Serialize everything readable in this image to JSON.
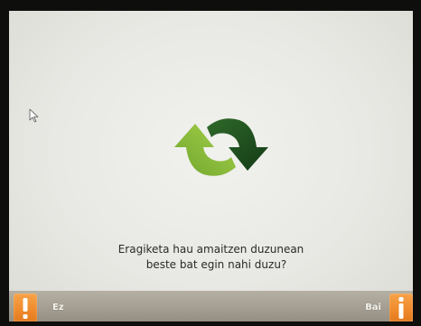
{
  "dialog": {
    "line1": "Eragiketa hau amaitzen duzunean",
    "line2": "beste bat egin nahi duzu?"
  },
  "buttons": {
    "no_label": "Ez",
    "yes_label": "Bai"
  },
  "icons": {
    "center": "refresh-icon",
    "no": "exclamation-icon",
    "yes": "info-icon",
    "pointer": "cursor-icon"
  },
  "colors": {
    "accent": "#ef8a2b",
    "icon_light_green": "#8fbf3a",
    "icon_dark_green": "#1f4a1e"
  }
}
